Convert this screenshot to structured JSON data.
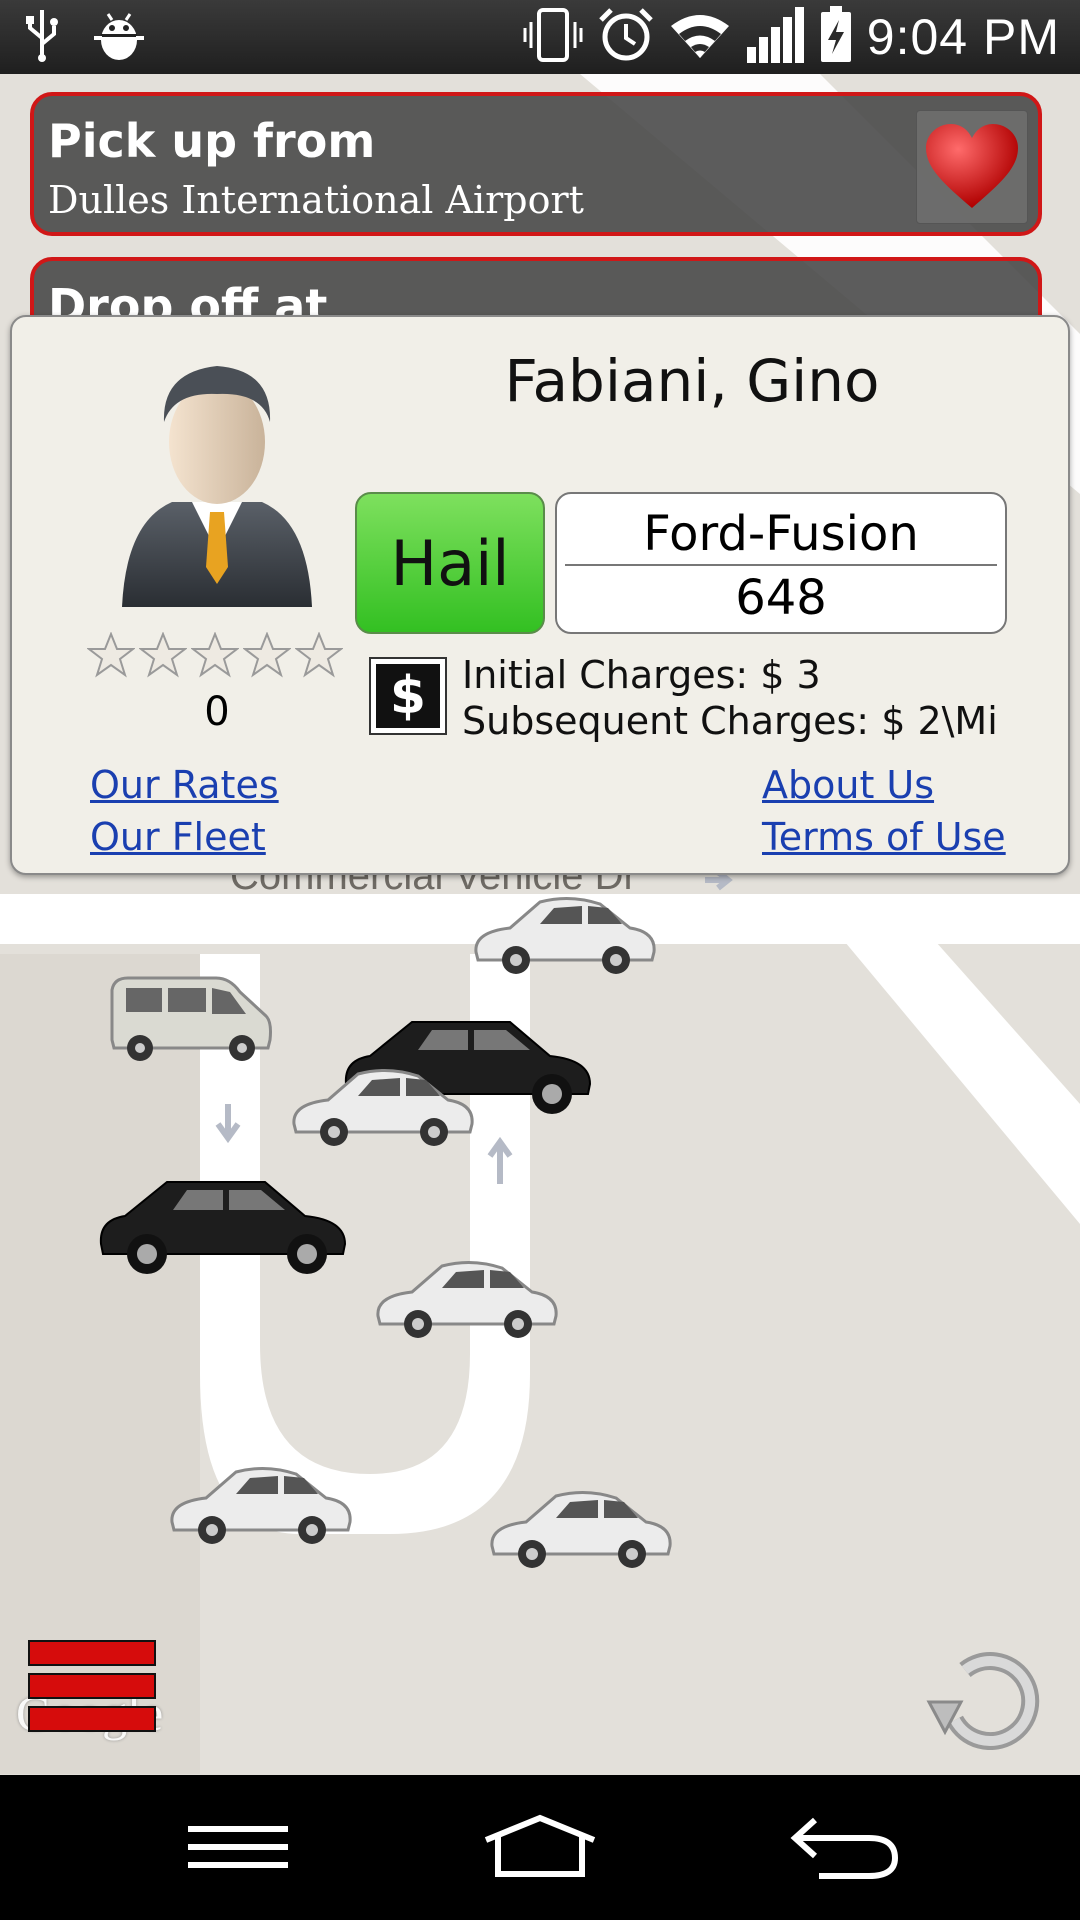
{
  "status_bar": {
    "time": "9:04 PM",
    "left_icons": [
      "usb-icon",
      "debug-android-icon"
    ],
    "right_icons": [
      "vibrate-icon",
      "alarm-icon",
      "wifi-icon",
      "signal-icon",
      "battery-charging-icon"
    ]
  },
  "pickup": {
    "title": "Pick up from",
    "value": "Dulles International Airport"
  },
  "dropoff": {
    "title": "Drop off at"
  },
  "favorite": {
    "icon": "heart-icon",
    "color": "#d61a1a"
  },
  "driver": {
    "name": "Fabiani, Gino",
    "rating": "0",
    "stars_total": 5,
    "stars_filled": 0,
    "hail_label": "Hail",
    "vehicle_model": "Ford-Fusion",
    "vehicle_number": "648",
    "initial_charges": "Initial Charges: $ 3",
    "subsequent_charges": "Subsequent Charges: $ 2\\Mi"
  },
  "links": {
    "our_rates": "Our Rates",
    "our_fleet": "Our Fleet",
    "about_us": "About Us",
    "terms_of_use": "Terms of Use"
  },
  "map": {
    "street_label": "Commercial Vehicle Dr",
    "attribution": "Google",
    "vehicles": [
      "sedan",
      "van",
      "suv",
      "sedan",
      "suv",
      "sedan",
      "sedan",
      "sedan"
    ]
  },
  "colors": {
    "accent_red": "#d01717",
    "hail_green": "#4ccd33",
    "link_blue": "#1a3fb0"
  }
}
